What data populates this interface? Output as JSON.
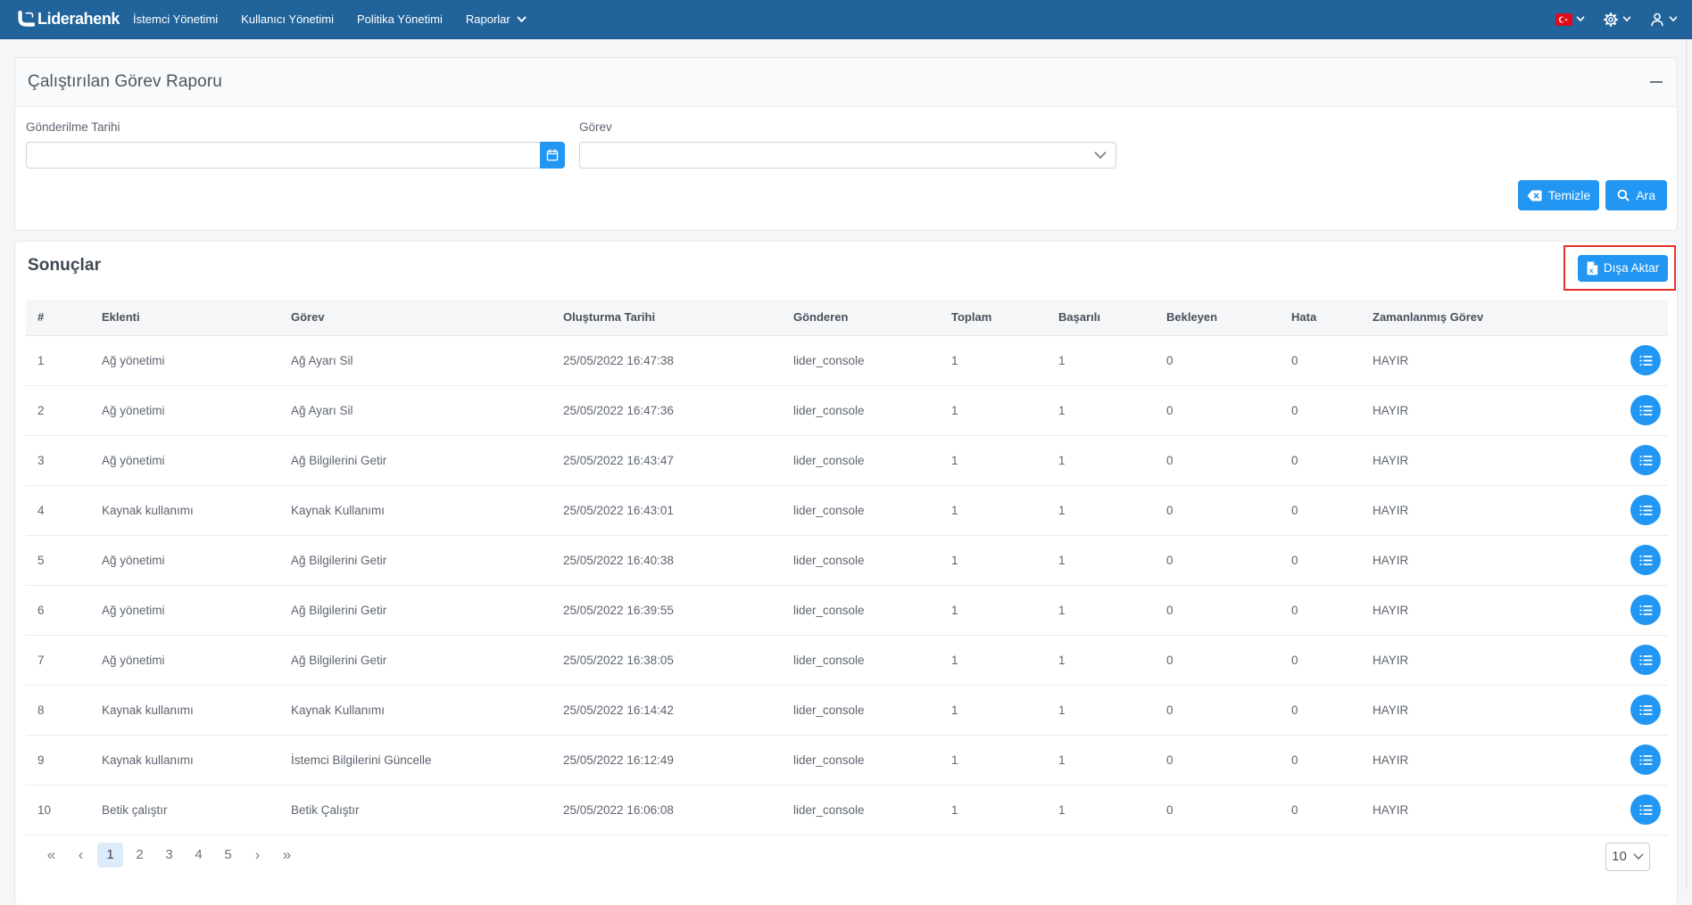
{
  "navbar": {
    "brand": "Liderahenk",
    "items": [
      {
        "label": "İstemci Yönetimi"
      },
      {
        "label": "Kullanıcı Yönetimi"
      },
      {
        "label": "Politika Yönetimi"
      },
      {
        "label": "Raporlar"
      }
    ]
  },
  "filter_card": {
    "title": "Çalıştırılan Görev Raporu",
    "date_field": {
      "label": "Gönderilme Tarihi",
      "value": ""
    },
    "task_field": {
      "label": "Görev",
      "value": ""
    },
    "buttons": {
      "clear": "Temizle",
      "search": "Ara"
    }
  },
  "results": {
    "title": "Sonuçlar",
    "export_label": "Dışa Aktar",
    "table": {
      "columns": [
        "#",
        "Eklenti",
        "Görev",
        "Oluşturma Tarihi",
        "Gönderen",
        "Toplam",
        "Başarılı",
        "Bekleyen",
        "Hata",
        "Zamanlanmış Görev"
      ],
      "rows": [
        [
          "1",
          "Ağ yönetimi",
          "Ağ Ayarı Sil",
          "25/05/2022 16:47:38",
          "lider_console",
          "1",
          "1",
          "0",
          "0",
          "HAYIR"
        ],
        [
          "2",
          "Ağ yönetimi",
          "Ağ Ayarı Sil",
          "25/05/2022 16:47:36",
          "lider_console",
          "1",
          "1",
          "0",
          "0",
          "HAYIR"
        ],
        [
          "3",
          "Ağ yönetimi",
          "Ağ Bilgilerini Getir",
          "25/05/2022 16:43:47",
          "lider_console",
          "1",
          "1",
          "0",
          "0",
          "HAYIR"
        ],
        [
          "4",
          "Kaynak kullanımı",
          "Kaynak Kullanımı",
          "25/05/2022 16:43:01",
          "lider_console",
          "1",
          "1",
          "0",
          "0",
          "HAYIR"
        ],
        [
          "5",
          "Ağ yönetimi",
          "Ağ Bilgilerini Getir",
          "25/05/2022 16:40:38",
          "lider_console",
          "1",
          "1",
          "0",
          "0",
          "HAYIR"
        ],
        [
          "6",
          "Ağ yönetimi",
          "Ağ Bilgilerini Getir",
          "25/05/2022 16:39:55",
          "lider_console",
          "1",
          "1",
          "0",
          "0",
          "HAYIR"
        ],
        [
          "7",
          "Ağ yönetimi",
          "Ağ Bilgilerini Getir",
          "25/05/2022 16:38:05",
          "lider_console",
          "1",
          "1",
          "0",
          "0",
          "HAYIR"
        ],
        [
          "8",
          "Kaynak kullanımı",
          "Kaynak Kullanımı",
          "25/05/2022 16:14:42",
          "lider_console",
          "1",
          "1",
          "0",
          "0",
          "HAYIR"
        ],
        [
          "9",
          "Kaynak kullanımı",
          "İstemci Bilgilerini Güncelle",
          "25/05/2022 16:12:49",
          "lider_console",
          "1",
          "1",
          "0",
          "0",
          "HAYIR"
        ],
        [
          "10",
          "Betik çalıştır",
          "Betik Çalıştır",
          "25/05/2022 16:06:08",
          "lider_console",
          "1",
          "1",
          "0",
          "0",
          "HAYIR"
        ]
      ]
    },
    "pagination": {
      "first_label": "«",
      "prev_label": "‹",
      "pages": [
        "1",
        "2",
        "3",
        "4",
        "5"
      ],
      "active_page": "1",
      "next_label": "›",
      "last_label": "»",
      "page_size": "10"
    }
  },
  "colors": {
    "navbar": "#21639b",
    "primary": "#2196f3",
    "annotation": "#e8312a",
    "flag_red": "#e30a17",
    "page_bg": "#f5f6f8"
  }
}
